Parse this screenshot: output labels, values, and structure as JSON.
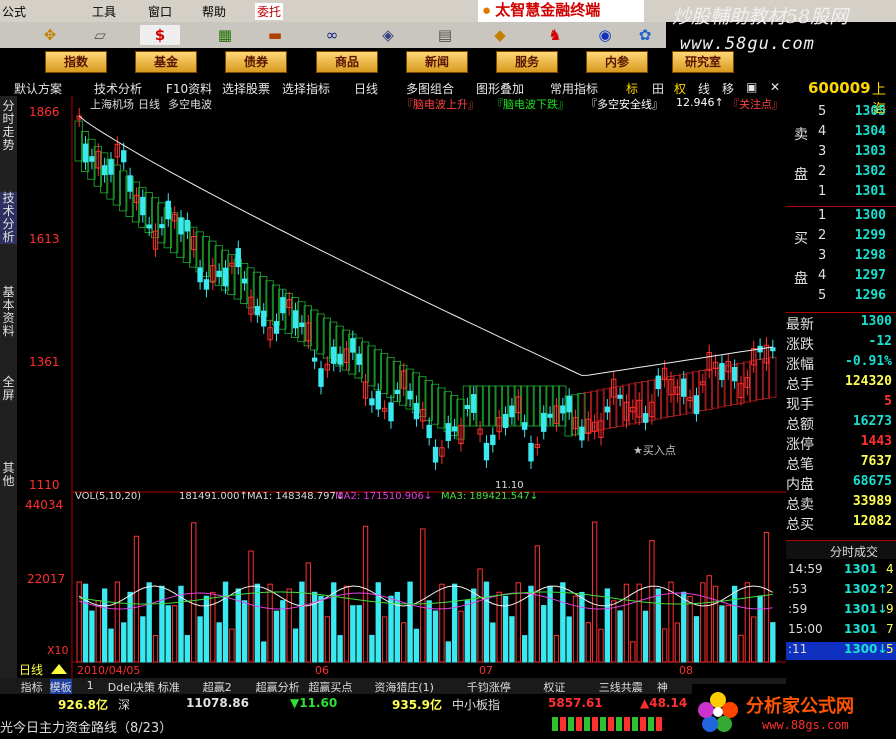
{
  "menu": [
    "公式",
    "工具",
    "窗口",
    "帮助",
    "委托"
  ],
  "brand": "太智慧金融终端",
  "watermark1": "炒股輔助教材58股网",
  "watermark2": "www.58gu.com",
  "nav": [
    "指数",
    "基金",
    "债券",
    "商品",
    "新闻",
    "服务",
    "内参",
    "研究室"
  ],
  "chart_toolbar": {
    "left": [
      "默认方案",
      "技术分析",
      "F10资料",
      "选择股票",
      "选择指标",
      "日线",
      "多图组合",
      "图形叠加",
      "常用指标"
    ],
    "right": [
      "标",
      "田",
      "权",
      "线",
      "移"
    ]
  },
  "vtabs": [
    "分时走势",
    "技术分析",
    "基本资料",
    "全屏",
    "其他"
  ],
  "chart_header": {
    "market": "上海机场",
    "period": "日线",
    "indicator": "多空电波",
    "legend_up": "『脑电波上升』",
    "legend_down": "『脑电波下跌』",
    "safe_line": "『多空安全线』",
    "safe_value": "12.946↑",
    "focus": "『关注点』"
  },
  "price_axis": [
    "1866",
    "1613",
    "1361",
    "1110"
  ],
  "chart_annotations": {
    "low_price": "11.10",
    "buy_point": "★买入点",
    "high_price": "1866"
  },
  "vol_header": {
    "name": "VOL(5,10,20)",
    "vol": "181491.000↑",
    "ma1": "MA1: 148348.797↓",
    "ma2": "MA2: 171510.906↓",
    "ma3": "MA3: 189421.547↓"
  },
  "vol_axis": [
    "44034",
    "22017",
    "X10"
  ],
  "date_axis": [
    "2010/04/05",
    "06",
    "07",
    "08"
  ],
  "period_label": "日线",
  "stock": {
    "code": "600009",
    "name": "上海"
  },
  "sell_orders": [
    {
      "lvl": "5",
      "price": "1305"
    },
    {
      "lvl": "4",
      "price": "1304"
    },
    {
      "lvl": "3",
      "price": "1303"
    },
    {
      "lvl": "2",
      "price": "1302"
    },
    {
      "lvl": "1",
      "price": "1301"
    }
  ],
  "buy_orders": [
    {
      "lvl": "1",
      "price": "1300"
    },
    {
      "lvl": "2",
      "price": "1299"
    },
    {
      "lvl": "3",
      "price": "1298"
    },
    {
      "lvl": "4",
      "price": "1297"
    },
    {
      "lvl": "5",
      "price": "1296"
    }
  ],
  "sell_label": [
    "卖",
    "盘"
  ],
  "buy_label": [
    "买",
    "盘"
  ],
  "quote": [
    {
      "label": "最新",
      "value": "1300",
      "color": "#19e0d0"
    },
    {
      "label": "涨跌",
      "value": "-12",
      "color": "#19e0d0"
    },
    {
      "label": "涨幅",
      "value": "-0.91%",
      "color": "#19e0d0"
    },
    {
      "label": "总手",
      "value": "124320",
      "color": "#ffff55"
    },
    {
      "label": "现手",
      "value": "5",
      "color": "#ff3030"
    },
    {
      "label": "总额",
      "value": "16273",
      "color": "#19e0d0"
    },
    {
      "label": "涨停",
      "value": "1443",
      "color": "#ff3030"
    },
    {
      "label": "总笔",
      "value": "7637",
      "color": "#ffff55"
    },
    {
      "label": "内盘",
      "value": "68675",
      "color": "#19e0d0"
    },
    {
      "label": "总卖",
      "value": "33989",
      "color": "#ffff55"
    },
    {
      "label": "总买",
      "value": "12082",
      "color": "#ffff55"
    }
  ],
  "timeshare_title": "分时成交",
  "ticks": [
    {
      "time": "14:59",
      "price": "1301",
      "vol": "4"
    },
    {
      "time": ":53",
      "price": "1302↑",
      "vol": "2"
    },
    {
      "time": ":59",
      "price": "1301↓",
      "vol": "9"
    },
    {
      "time": "15:00",
      "price": "1301",
      "vol": "7"
    },
    {
      "time": ":11",
      "price": "1300↓",
      "vol": "5"
    }
  ],
  "bottom_tabs": [
    "指标",
    "模板",
    "1",
    "Ddel决策",
    "标准",
    "超赢2",
    "超赢分析",
    "超赢买点",
    "资海猎庄(1)",
    "千钧涨停",
    "权证",
    "三线共震",
    "神"
  ],
  "status": {
    "vol1": "926.8亿",
    "market2": "深",
    "idx2": "11078.86",
    "chg2": "▼11.60",
    "vol2": "935.9亿",
    "board": "中小板指",
    "idx3": "5857.61",
    "chg3": "▲48.14"
  },
  "status2": {
    "text": "光今日主力资金路线（8/23）"
  },
  "logo88": {
    "title": "分析家公式网",
    "url": "www.88gs.com"
  },
  "colors": {
    "up": "#ff3030",
    "down": "#3ae8f0",
    "ma_white": "#f0f0f0",
    "band_green": "#1fb030",
    "band_red": "#c02020",
    "accent": "#ffd700"
  }
}
